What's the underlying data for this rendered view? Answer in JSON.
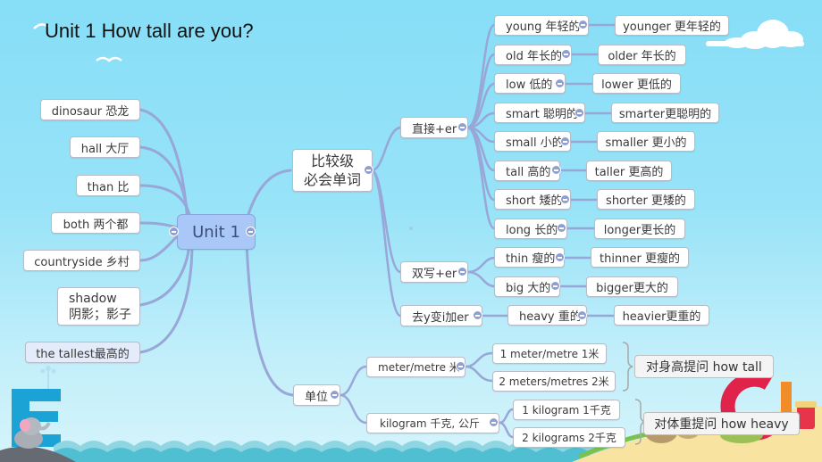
{
  "title": "Unit 1  How tall are you?",
  "central": {
    "label": "Unit 1"
  },
  "left_words": [
    {
      "label": "dinosaur 恐龙"
    },
    {
      "label": "hall 大厅"
    },
    {
      "label": "than 比"
    },
    {
      "label": "both 两个都"
    },
    {
      "label": "countryside 乡村"
    },
    {
      "label_line1": "shadow",
      "label_line2": "阴影；影子"
    },
    {
      "label": "the tallest最高的"
    }
  ],
  "comparative": {
    "label_line1": "比较级",
    "label_line2": "必会单词",
    "rules": [
      {
        "label": "直接+er",
        "words": [
          {
            "base": "young 年轻的",
            "comp": "younger 更年轻的"
          },
          {
            "base": "old 年长的",
            "comp": "older 年长的"
          },
          {
            "base": "low 低的",
            "comp": "lower 更低的"
          },
          {
            "base": "smart 聪明的",
            "comp": "smarter更聪明的"
          },
          {
            "base": "small 小的",
            "comp": "smaller 更小的"
          },
          {
            "base": "tall 高的",
            "comp": "taller 更高的"
          },
          {
            "base": "short 矮的",
            "comp": "shorter 更矮的"
          },
          {
            "base": "long 长的",
            "comp": "longer更长的"
          }
        ]
      },
      {
        "label": "双写+er",
        "words": [
          {
            "base": "thin 瘦的",
            "comp": "thinner 更瘦的"
          },
          {
            "base": "big 大的",
            "comp": "bigger更大的"
          }
        ]
      },
      {
        "label": "去y变i加er",
        "words": [
          {
            "base": "heavy 重的",
            "comp": "heavier更重的"
          }
        ]
      }
    ]
  },
  "units": {
    "label": "单位",
    "groups": [
      {
        "label": "meter/metre 米",
        "items": [
          "1 meter/metre 1米",
          "2 meters/metres 2米"
        ],
        "note": "对身高提问 how tall"
      },
      {
        "label": "kilogram 千克, 公斤",
        "items": [
          "1 kilogram 1千克",
          "2  kilograms 2千克"
        ],
        "note": "对体重提问 how heavy"
      }
    ]
  },
  "colors": {
    "connector": "#98a6d8",
    "central_fill": "#a9c7f7",
    "sky": "#86def7",
    "wave": "#5cc6d8"
  }
}
